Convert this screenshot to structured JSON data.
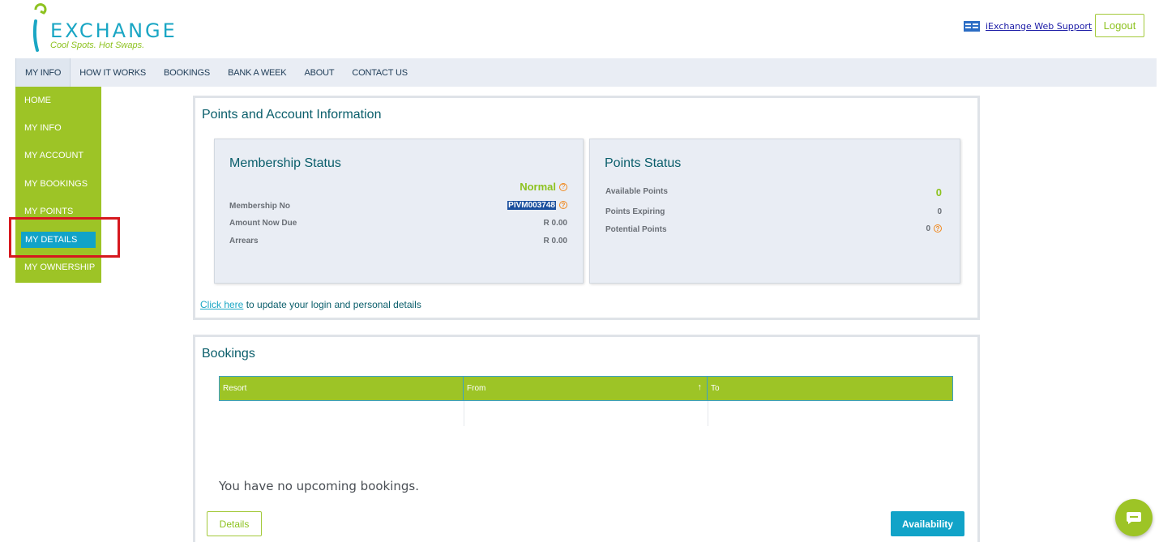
{
  "brand": {
    "name": "EXCHANGE",
    "tagline": "Cool Spots. Hot Swaps."
  },
  "header": {
    "support_label": "iExchange Web Support",
    "logout_label": "Logout"
  },
  "topnav": {
    "items": [
      {
        "label": "MY INFO",
        "active": true
      },
      {
        "label": "HOW IT WORKS"
      },
      {
        "label": "BOOKINGS"
      },
      {
        "label": "BANK A WEEK"
      },
      {
        "label": "ABOUT"
      },
      {
        "label": "CONTACT US"
      }
    ]
  },
  "sidebar": {
    "items": [
      {
        "label": "HOME"
      },
      {
        "label": "MY INFO"
      },
      {
        "label": "MY ACCOUNT"
      },
      {
        "label": "MY BOOKINGS"
      },
      {
        "label": "MY POINTS"
      },
      {
        "label": "MY DETAILS",
        "selected": true
      },
      {
        "label": "MY OWNERSHIP"
      }
    ]
  },
  "points_panel": {
    "title": "Points and Account Information",
    "membership": {
      "title": "Membership Status",
      "status": "Normal",
      "rows": [
        {
          "label": "Membership No",
          "value": "PIVM003748"
        },
        {
          "label": "Amount Now Due",
          "value": "R 0.00"
        },
        {
          "label": "Arrears",
          "value": "R 0.00"
        }
      ]
    },
    "points": {
      "title": "Points Status",
      "rows": [
        {
          "label": "Available Points",
          "value": "0"
        },
        {
          "label": "Points Expiring",
          "value": "0"
        },
        {
          "label": "Potential Points",
          "value": "0"
        }
      ]
    },
    "link_text": "Click here",
    "link_suffix": " to update your login and personal details"
  },
  "bookings_panel": {
    "title": "Bookings",
    "columns": [
      "Resort",
      "From",
      "To"
    ],
    "empty_message": "You have no upcoming bookings.",
    "details_label": "Details",
    "availability_label": "Availability"
  },
  "colors": {
    "brand_green": "#9dc426",
    "brand_blue": "#11a3c8",
    "title_teal": "#0a5e6b",
    "highlight_red": "#d6181f"
  }
}
